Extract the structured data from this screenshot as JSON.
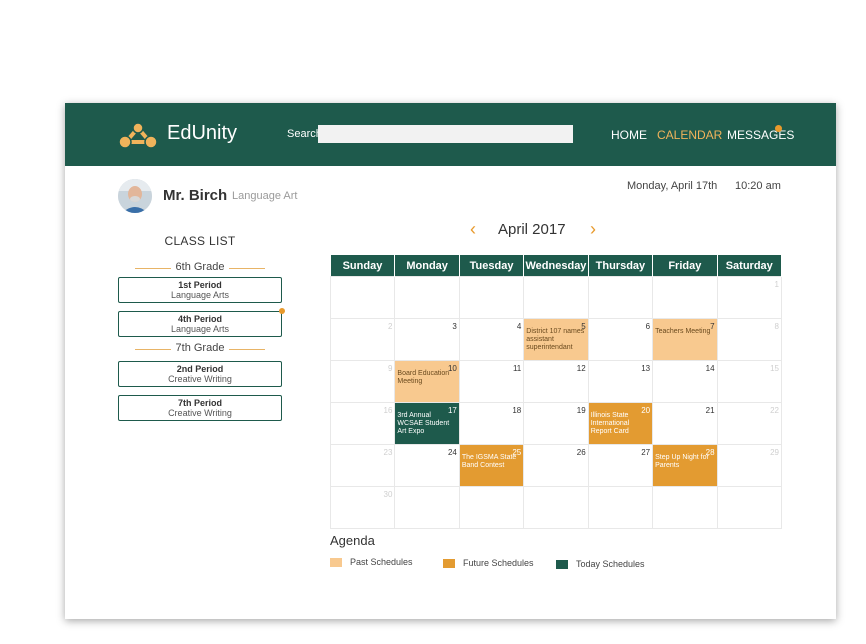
{
  "header": {
    "brand": "EdUnity",
    "search_label": "Search",
    "search_placeholder": "",
    "nav": [
      {
        "label": "HOME"
      },
      {
        "label": "CALENDAR",
        "active": true
      },
      {
        "label": "MESSAGES"
      }
    ]
  },
  "teacher": {
    "name": "Mr. Birch",
    "subject": "Language Art"
  },
  "datetime": {
    "date": "Monday, April 17th",
    "time": "10:20 am"
  },
  "classlist": {
    "title": "CLASS LIST",
    "grades": [
      {
        "label": "6th Grade",
        "classes": [
          {
            "period": "1st Period",
            "subject": "Language Arts"
          },
          {
            "period": "4th Period",
            "subject": "Language Arts",
            "notification": true
          }
        ]
      },
      {
        "label": "7th Grade",
        "classes": [
          {
            "period": "2nd Period",
            "subject": "Creative Writing"
          },
          {
            "period": "7th Period",
            "subject": "Creative Writing"
          }
        ]
      }
    ]
  },
  "calendar": {
    "month_label": "April 2017",
    "prev_icon": "chevron-left-icon",
    "next_icon": "chevron-right-icon",
    "days": [
      "Sunday",
      "Monday",
      "Tuesday",
      "Wednesday",
      "Thursday",
      "Friday",
      "Saturday"
    ],
    "weeks": [
      [
        {
          "num": ""
        },
        {
          "num": ""
        },
        {
          "num": ""
        },
        {
          "num": ""
        },
        {
          "num": ""
        },
        {
          "num": ""
        },
        {
          "num": "1",
          "dim": true
        }
      ],
      [
        {
          "num": "2",
          "dim": true
        },
        {
          "num": "3"
        },
        {
          "num": "4"
        },
        {
          "num": "5",
          "event": "District 107 names assistant superintendant",
          "type": "past"
        },
        {
          "num": "6"
        },
        {
          "num": "7",
          "event": "Teachers Meeting",
          "type": "past"
        },
        {
          "num": "8",
          "dim": true
        }
      ],
      [
        {
          "num": "9",
          "dim": true
        },
        {
          "num": "10",
          "event": "Board Education Meeting",
          "type": "past"
        },
        {
          "num": "11"
        },
        {
          "num": "12"
        },
        {
          "num": "13"
        },
        {
          "num": "14"
        },
        {
          "num": "15",
          "dim": true
        }
      ],
      [
        {
          "num": "16",
          "dim": true
        },
        {
          "num": "17",
          "event": "3rd Annual WCSAE Student Art Expo",
          "type": "today"
        },
        {
          "num": "18"
        },
        {
          "num": "19"
        },
        {
          "num": "20",
          "event": "Illinois State International Report Card",
          "type": "future"
        },
        {
          "num": "21"
        },
        {
          "num": "22",
          "dim": true
        }
      ],
      [
        {
          "num": "23",
          "dim": true
        },
        {
          "num": "24"
        },
        {
          "num": "25",
          "event": "The IGSMA State Band Contest",
          "type": "future"
        },
        {
          "num": "26"
        },
        {
          "num": "27"
        },
        {
          "num": "28",
          "event": "Step Up Night for Parents",
          "type": "future"
        },
        {
          "num": "29",
          "dim": true
        }
      ],
      [
        {
          "num": "30",
          "dim": true
        },
        {
          "num": ""
        },
        {
          "num": ""
        },
        {
          "num": ""
        },
        {
          "num": ""
        },
        {
          "num": ""
        },
        {
          "num": ""
        }
      ]
    ]
  },
  "agenda": {
    "title": "Agenda",
    "legend": [
      {
        "label": "Past Schedules",
        "color": "#f8c98f"
      },
      {
        "label": "Future Schedules",
        "color": "#e39b31"
      },
      {
        "label": "Today Schedules",
        "color": "#1e5a4c"
      }
    ]
  },
  "colors": {
    "primary": "#1e5a4c",
    "accent": "#e89a2c",
    "past": "#f8c98f",
    "future": "#e39b31"
  }
}
